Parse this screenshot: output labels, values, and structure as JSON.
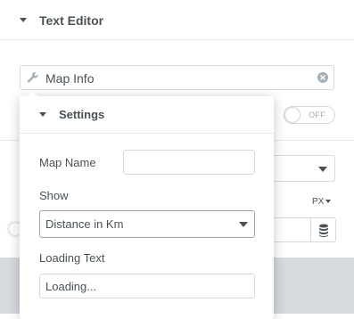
{
  "section": {
    "title": "Text Editor"
  },
  "search": {
    "value": "Map Info"
  },
  "underlying": {
    "toggle_label": "OFF",
    "unit_label": "PX"
  },
  "popover": {
    "title": "Settings",
    "map_name": {
      "label": "Map Name",
      "value": ""
    },
    "show": {
      "label": "Show",
      "value": "Distance in Km"
    },
    "loading_text": {
      "label": "Loading Text",
      "value": "Loading..."
    }
  },
  "colors": {
    "text": "#495157",
    "border": "#d5dadf",
    "grey_area": "#d5dadf"
  },
  "icons": [
    "caret-down-icon",
    "wrench-icon",
    "clear-icon",
    "database-icon",
    "chevron-down-icon"
  ]
}
